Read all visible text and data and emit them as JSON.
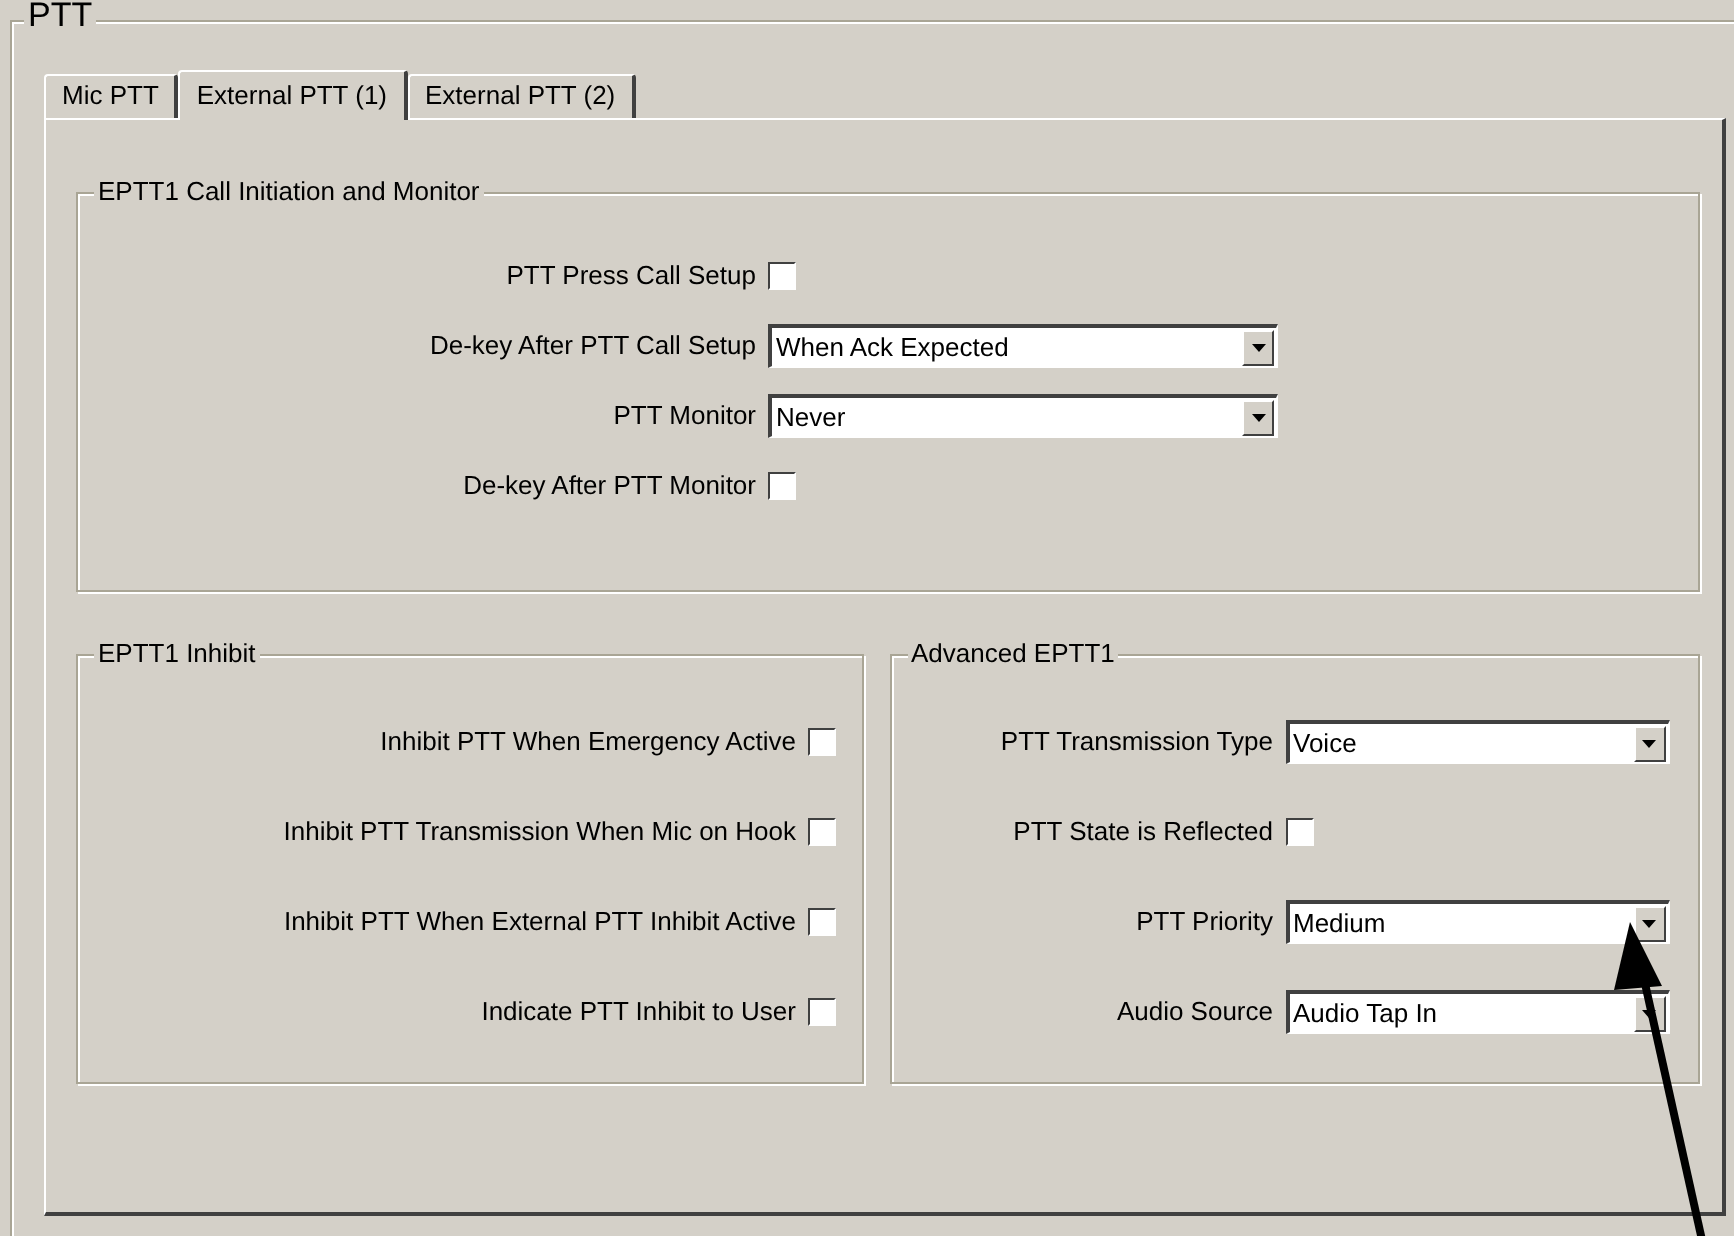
{
  "group": {
    "title": "PTT"
  },
  "tabs": [
    {
      "label": "Mic PTT",
      "selected": false
    },
    {
      "label": "External PTT (1)",
      "selected": true
    },
    {
      "label": "External PTT (2)",
      "selected": false
    }
  ],
  "sections": [
    {
      "title": "EPTT1 Call Initiation and Monitor",
      "rows": [
        {
          "kind": "checkbox",
          "label": "PTT Press Call Setup",
          "checked": false
        },
        {
          "kind": "dropdown",
          "label": "De-key After PTT Call Setup",
          "value": "When Ack Expected"
        },
        {
          "kind": "dropdown",
          "label": "PTT Monitor",
          "value": "Never"
        },
        {
          "kind": "checkbox",
          "label": "De-key After PTT Monitor",
          "checked": false
        }
      ]
    },
    {
      "title": "EPTT1 Inhibit",
      "rows": [
        {
          "kind": "checkbox",
          "label": "Inhibit PTT When Emergency Active",
          "checked": false
        },
        {
          "kind": "checkbox",
          "label": "Inhibit PTT Transmission When Mic on Hook",
          "checked": false
        },
        {
          "kind": "checkbox",
          "label": "Inhibit PTT When External PTT Inhibit Active",
          "checked": false
        },
        {
          "kind": "checkbox",
          "label": "Indicate PTT Inhibit to User",
          "checked": false
        }
      ]
    },
    {
      "title": "Advanced EPTT1",
      "rows": [
        {
          "kind": "dropdown",
          "label": "PTT Transmission Type",
          "value": "Voice"
        },
        {
          "kind": "checkbox",
          "label": "PTT State is Reflected",
          "checked": false
        },
        {
          "kind": "dropdown",
          "label": "PTT Priority",
          "value": "Medium"
        },
        {
          "kind": "dropdown",
          "label": "Audio Source",
          "value": "Audio Tap In"
        }
      ]
    }
  ]
}
